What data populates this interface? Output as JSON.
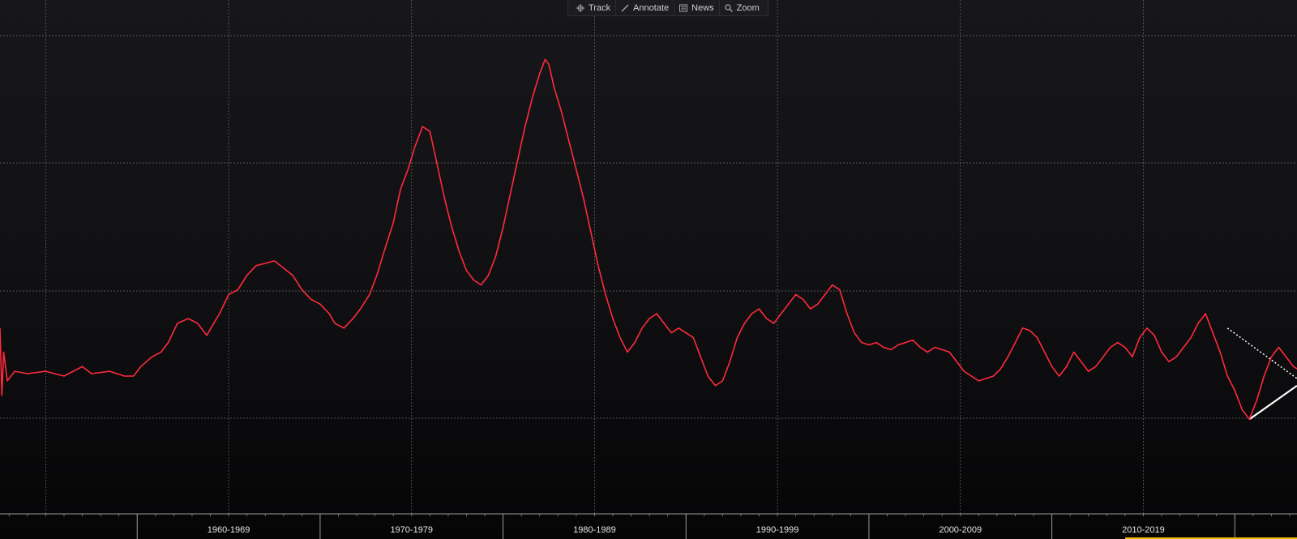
{
  "toolbar": {
    "items": [
      {
        "label": "Track",
        "icon": "crosshair-icon"
      },
      {
        "label": "Annotate",
        "icon": "pencil-icon"
      },
      {
        "label": "News",
        "icon": "news-icon"
      },
      {
        "label": "Zoom",
        "icon": "magnifier-icon"
      }
    ]
  },
  "colors": {
    "series": "#ff2a3c",
    "grid": "#6a6a70",
    "trendline": "#ffffff",
    "axis_text": "#e6e6e6",
    "highlight": "#f0b400"
  },
  "chart_data": {
    "type": "line",
    "title": "",
    "xlabel": "",
    "ylabel": "",
    "x_range": [
      1952.5,
      2023.4
    ],
    "y_range": [
      0,
      100
    ],
    "grid": true,
    "y_tick_labels_shown": false,
    "decade_labels": [
      {
        "label": "1960-1969",
        "start": 1960,
        "end": 1970
      },
      {
        "label": "1970-1979",
        "start": 1970,
        "end": 1980
      },
      {
        "label": "1980-1989",
        "start": 1980,
        "end": 1990
      },
      {
        "label": "1990-1999",
        "start": 1990,
        "end": 2000
      },
      {
        "label": "2000-2009",
        "start": 2000,
        "end": 2010
      },
      {
        "label": "2010-2019",
        "start": 2010,
        "end": 2020
      }
    ],
    "series": [
      {
        "name": "",
        "points": [
          [
            1952.5,
            35.0
          ],
          [
            1952.6,
            21.0
          ],
          [
            1952.7,
            30.0
          ],
          [
            1952.9,
            24.0
          ],
          [
            1953.3,
            26.0
          ],
          [
            1954.0,
            25.5
          ],
          [
            1955.0,
            26.0
          ],
          [
            1956.0,
            25.0
          ],
          [
            1957.0,
            27.0
          ],
          [
            1957.5,
            25.5
          ],
          [
            1958.5,
            26.0
          ],
          [
            1959.3,
            25.0
          ],
          [
            1959.8,
            25.0
          ],
          [
            1960.2,
            27.0
          ],
          [
            1960.8,
            29.0
          ],
          [
            1961.3,
            30.0
          ],
          [
            1961.7,
            32.0
          ],
          [
            1962.2,
            36.0
          ],
          [
            1962.8,
            37.0
          ],
          [
            1963.3,
            36.0
          ],
          [
            1963.8,
            33.5
          ],
          [
            1964.5,
            38.0
          ],
          [
            1965.0,
            42.0
          ],
          [
            1965.5,
            43.0
          ],
          [
            1966.0,
            46.0
          ],
          [
            1966.5,
            48.0
          ],
          [
            1967.0,
            48.5
          ],
          [
            1967.5,
            49.0
          ],
          [
            1968.0,
            47.5
          ],
          [
            1968.5,
            46.0
          ],
          [
            1969.0,
            43.0
          ],
          [
            1969.5,
            41.0
          ],
          [
            1970.0,
            40.0
          ],
          [
            1970.5,
            38.0
          ],
          [
            1970.8,
            36.0
          ],
          [
            1971.3,
            35.0
          ],
          [
            1971.8,
            37.0
          ],
          [
            1972.2,
            39.0
          ],
          [
            1972.7,
            42.0
          ],
          [
            1973.1,
            46.0
          ],
          [
            1973.5,
            51.0
          ],
          [
            1974.0,
            57.0
          ],
          [
            1974.4,
            64.0
          ],
          [
            1974.8,
            68.0
          ],
          [
            1975.2,
            73.0
          ],
          [
            1975.6,
            77.0
          ],
          [
            1976.0,
            76.0
          ],
          [
            1976.4,
            69.0
          ],
          [
            1976.8,
            62.0
          ],
          [
            1977.2,
            56.0
          ],
          [
            1977.6,
            51.0
          ],
          [
            1978.0,
            47.0
          ],
          [
            1978.4,
            45.0
          ],
          [
            1978.8,
            44.0
          ],
          [
            1979.2,
            46.0
          ],
          [
            1979.6,
            50.0
          ],
          [
            1980.0,
            56.0
          ],
          [
            1980.4,
            63.0
          ],
          [
            1980.8,
            70.0
          ],
          [
            1981.2,
            77.0
          ],
          [
            1981.6,
            83.0
          ],
          [
            1982.0,
            88.0
          ],
          [
            1982.3,
            91.0
          ],
          [
            1982.5,
            90.0
          ],
          [
            1982.8,
            85.0
          ],
          [
            1983.2,
            80.0
          ],
          [
            1983.6,
            74.0
          ],
          [
            1984.0,
            68.0
          ],
          [
            1984.4,
            62.0
          ],
          [
            1984.8,
            55.0
          ],
          [
            1985.2,
            48.0
          ],
          [
            1985.6,
            42.0
          ],
          [
            1986.0,
            37.0
          ],
          [
            1986.4,
            33.0
          ],
          [
            1986.8,
            30.0
          ],
          [
            1987.2,
            32.0
          ],
          [
            1987.6,
            35.0
          ],
          [
            1988.0,
            37.0
          ],
          [
            1988.4,
            38.0
          ],
          [
            1988.8,
            36.0
          ],
          [
            1989.2,
            34.0
          ],
          [
            1989.6,
            35.0
          ],
          [
            1990.0,
            34.0
          ],
          [
            1990.4,
            33.0
          ],
          [
            1990.8,
            29.0
          ],
          [
            1991.2,
            25.0
          ],
          [
            1991.6,
            23.0
          ],
          [
            1992.0,
            24.0
          ],
          [
            1992.4,
            28.0
          ],
          [
            1992.8,
            33.0
          ],
          [
            1993.2,
            36.0
          ],
          [
            1993.6,
            38.0
          ],
          [
            1994.0,
            39.0
          ],
          [
            1994.4,
            37.0
          ],
          [
            1994.8,
            36.0
          ],
          [
            1995.2,
            38.0
          ],
          [
            1995.6,
            40.0
          ],
          [
            1996.0,
            42.0
          ],
          [
            1996.4,
            41.0
          ],
          [
            1996.8,
            39.0
          ],
          [
            1997.2,
            40.0
          ],
          [
            1997.6,
            42.0
          ],
          [
            1998.0,
            44.0
          ],
          [
            1998.4,
            43.0
          ],
          [
            1998.8,
            38.0
          ],
          [
            1999.2,
            34.0
          ],
          [
            1999.6,
            32.0
          ],
          [
            2000.0,
            31.5
          ],
          [
            2000.4,
            32.0
          ],
          [
            2000.8,
            31.0
          ],
          [
            2001.2,
            30.5
          ],
          [
            2001.6,
            31.5
          ],
          [
            2002.0,
            32.0
          ],
          [
            2002.4,
            32.5
          ],
          [
            2002.8,
            31.0
          ],
          [
            2003.2,
            30.0
          ],
          [
            2003.6,
            31.0
          ],
          [
            2004.0,
            30.5
          ],
          [
            2004.4,
            30.0
          ],
          [
            2004.8,
            28.0
          ],
          [
            2005.2,
            26.0
          ],
          [
            2005.6,
            25.0
          ],
          [
            2006.0,
            24.0
          ],
          [
            2006.4,
            24.5
          ],
          [
            2006.8,
            25.0
          ],
          [
            2007.2,
            26.5
          ],
          [
            2007.6,
            29.0
          ],
          [
            2008.0,
            32.0
          ],
          [
            2008.4,
            35.0
          ],
          [
            2008.8,
            34.5
          ],
          [
            2009.2,
            33.0
          ],
          [
            2009.6,
            30.0
          ],
          [
            2010.0,
            27.0
          ],
          [
            2010.4,
            25.0
          ],
          [
            2010.8,
            27.0
          ],
          [
            2011.2,
            30.0
          ],
          [
            2011.6,
            28.0
          ],
          [
            2012.0,
            26.0
          ],
          [
            2012.4,
            27.0
          ],
          [
            2012.8,
            29.0
          ],
          [
            2013.2,
            31.0
          ],
          [
            2013.6,
            32.0
          ],
          [
            2014.0,
            31.0
          ],
          [
            2014.4,
            29.0
          ],
          [
            2014.8,
            33.0
          ],
          [
            2015.2,
            35.0
          ],
          [
            2015.6,
            33.5
          ],
          [
            2016.0,
            30.0
          ],
          [
            2016.4,
            28.0
          ],
          [
            2016.8,
            29.0
          ],
          [
            2017.2,
            31.0
          ],
          [
            2017.6,
            33.0
          ],
          [
            2018.0,
            36.0
          ],
          [
            2018.4,
            38.0
          ],
          [
            2018.8,
            34.0
          ],
          [
            2019.2,
            30.0
          ],
          [
            2019.6,
            25.0
          ],
          [
            2020.0,
            22.0
          ],
          [
            2020.4,
            18.0
          ],
          [
            2020.8,
            16.0
          ],
          [
            2021.2,
            20.0
          ],
          [
            2021.6,
            25.0
          ],
          [
            2022.0,
            29.0
          ],
          [
            2022.4,
            31.0
          ],
          [
            2022.8,
            29.0
          ],
          [
            2023.2,
            27.0
          ],
          [
            2023.4,
            26.5
          ]
        ]
      }
    ]
  }
}
